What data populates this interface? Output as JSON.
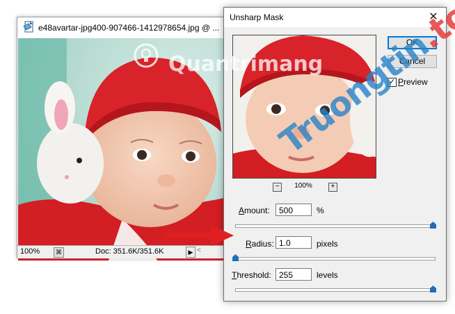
{
  "document_window": {
    "title": "e48avartar-jpg400-907466-1412978654.jpg @ ...",
    "zoom": "100%",
    "doc_size": "Doc: 351.6K/351.6K",
    "arrow_glyph": "▶",
    "scroll_left_glyph": "<"
  },
  "dialog": {
    "title": "Unsharp Mask",
    "close_glyph": "✕",
    "ok_label": "OK",
    "cancel_label": "Cancel",
    "preview_key": "P",
    "preview_rest": "review",
    "preview_checked": true,
    "check_glyph": "✓",
    "preview_zoom": "100%",
    "zoom_minus": "−",
    "zoom_plus": "+",
    "amount": {
      "key": "A",
      "rest": "mount:",
      "value": "500",
      "unit": "%",
      "level": 1.0
    },
    "radius": {
      "key": "R",
      "rest": "adius:",
      "value": "1.0",
      "unit": "pixels",
      "level": 0.0
    },
    "threshold": {
      "key": "T",
      "rest": "hreshold:",
      "value": "255",
      "unit": "levels",
      "level": 1.0
    }
  },
  "watermarks": {
    "photo_text": "Quantrimang",
    "site_name": "Truongtin",
    "site_tld": ".top"
  },
  "colors": {
    "annotation_arrow": "#e02020",
    "slider_thumb": "#1e6fb8",
    "ok_border": "#0078d7"
  },
  "icons": {
    "document": "photoshop-document-icon",
    "close": "close-icon",
    "arrow": "red-pointer-arrow"
  }
}
